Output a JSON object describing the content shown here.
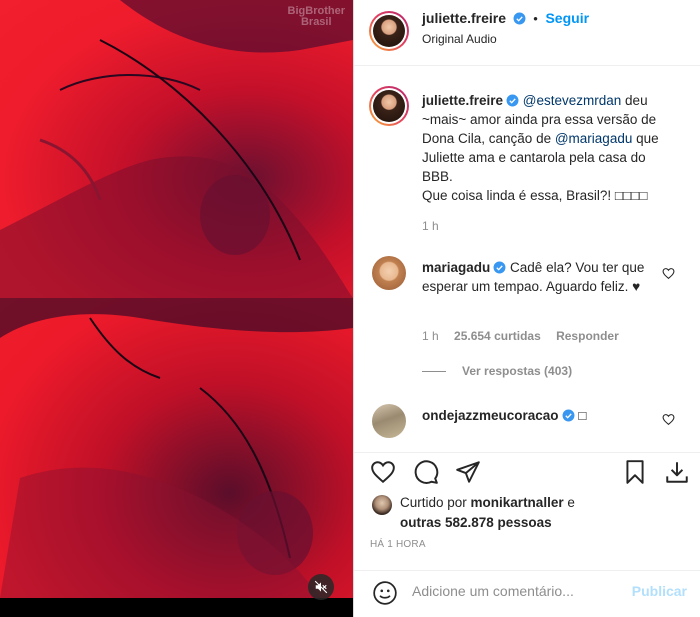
{
  "media": {
    "watermark": "BigBrother\nBrasil",
    "mute_icon": "speaker-muted-icon"
  },
  "header": {
    "username": "juliette.freire",
    "separator": "•",
    "follow_label": "Seguir",
    "subtitle": "Original Audio"
  },
  "caption": {
    "username": "juliette.freire",
    "mention1": "@estevezmrdan",
    "text1": " deu ~mais~ amor ainda pra essa versão de Dona Cila, canção de ",
    "mention2": "@mariagadu",
    "text2": " que Juliette ama e cantarola pela casa do BBB.",
    "text3": "Que coisa linda é essa, Brasil?! ",
    "emoji": "□□□□",
    "time": "1 h"
  },
  "comment1": {
    "username": "mariagadu",
    "text": "Cadê ela? Vou ter que esperar um tempao. Aguardo feliz. ♥",
    "time": "1 h",
    "likes": "25.654 curtidas",
    "reply": "Responder",
    "view_replies": "Ver respostas (403)"
  },
  "comment2": {
    "username": "ondejazzmeucoracao",
    "text": "□"
  },
  "actions": {
    "liked_prefix": "Curtido por ",
    "liked_user": "monikartnaller",
    "liked_mid": " e",
    "liked_others": "outras 582.878 pessoas",
    "time": "HÁ 1 HORA"
  },
  "add_comment": {
    "placeholder": "Adicione um comentário...",
    "publish": "Publicar"
  },
  "colors": {
    "accent": "#0095f6",
    "mention": "#00376b",
    "muted": "#8e8e8e",
    "publish_disabled": "#b2dffc"
  }
}
